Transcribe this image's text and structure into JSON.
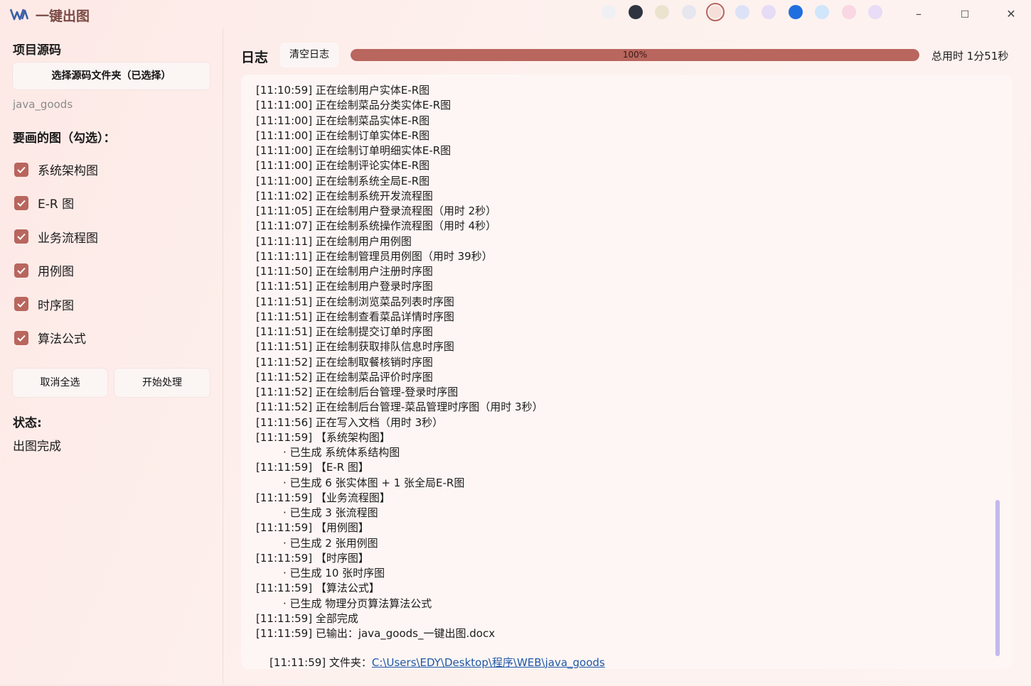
{
  "window": {
    "title": "一键出图",
    "controls": {
      "minimize": "–",
      "maximize": "□",
      "close": "✕"
    }
  },
  "theme": {
    "accent": "#b8665e",
    "swatches": [
      "#eef0f4",
      "#2f3440",
      "#ece3cf",
      "#e6e6ee",
      "#f6dfd9",
      "#dde3f7",
      "#e6dcf6",
      "#1f6fe0",
      "#cfe6fb",
      "#f9d7e3",
      "#e9dcf6"
    ],
    "selected_swatch": 4
  },
  "sidebar": {
    "project_title": "项目源码",
    "select_button": "选择源码文件夹（已选择）",
    "folder_name": "java_goods",
    "diagrams_title": "要画的图（勾选）：",
    "diagrams": [
      {
        "label": "系统架构图",
        "checked": true
      },
      {
        "label": "E-R 图",
        "checked": true
      },
      {
        "label": "业务流程图",
        "checked": true
      },
      {
        "label": "用例图",
        "checked": true
      },
      {
        "label": "时序图",
        "checked": true
      },
      {
        "label": "算法公式",
        "checked": true
      }
    ],
    "deselect_all_button": "取消全选",
    "start_button": "开始处理",
    "status_title": "状态:",
    "status_value": "出图完成"
  },
  "log": {
    "title": "日志",
    "clear_button": "清空日志",
    "progress": 100,
    "progress_text": "100%",
    "total_time": "总用时 1分51秒",
    "link_prefix": "[11:11:59] 文件夹：",
    "link_text": "C:\\Users\\EDY\\Desktop\\程序\\WEB\\java_goods",
    "lines": [
      {
        "text": "[11:10:59] 正在绘制用户实体E-R图"
      },
      {
        "text": "[11:11:00] 正在绘制菜品分类实体E-R图"
      },
      {
        "text": "[11:11:00] 正在绘制菜品实体E-R图"
      },
      {
        "text": "[11:11:00] 正在绘制订单实体E-R图"
      },
      {
        "text": "[11:11:00] 正在绘制订单明细实体E-R图"
      },
      {
        "text": "[11:11:00] 正在绘制评论实体E-R图"
      },
      {
        "text": "[11:11:00] 正在绘制系统全局E-R图"
      },
      {
        "text": "[11:11:02] 正在绘制系统开发流程图"
      },
      {
        "text": "[11:11:05] 正在绘制用户登录流程图（用时 2秒）"
      },
      {
        "text": "[11:11:07] 正在绘制系统操作流程图（用时 4秒）"
      },
      {
        "text": "[11:11:11] 正在绘制用户用例图"
      },
      {
        "text": "[11:11:11] 正在绘制管理员用例图（用时 39秒）"
      },
      {
        "text": "[11:11:50] 正在绘制用户注册时序图"
      },
      {
        "text": "[11:11:51] 正在绘制用户登录时序图"
      },
      {
        "text": "[11:11:51] 正在绘制浏览菜品列表时序图"
      },
      {
        "text": "[11:11:51] 正在绘制查看菜品详情时序图"
      },
      {
        "text": "[11:11:51] 正在绘制提交订单时序图"
      },
      {
        "text": "[11:11:51] 正在绘制获取排队信息时序图"
      },
      {
        "text": "[11:11:52] 正在绘制取餐核销时序图"
      },
      {
        "text": "[11:11:52] 正在绘制菜品评价时序图"
      },
      {
        "text": "[11:11:52] 正在绘制后台管理-登录时序图"
      },
      {
        "text": "[11:11:52] 正在绘制后台管理-菜品管理时序图（用时 3秒）"
      },
      {
        "text": "[11:11:56] 正在写入文档（用时 3秒）"
      },
      {
        "text": "[11:11:59] 【系统架构图】"
      },
      {
        "text": "· 已生成 系统体系结构图",
        "sub": true
      },
      {
        "text": "[11:11:59] 【E-R 图】"
      },
      {
        "text": "· 已生成 6 张实体图 + 1 张全局E-R图",
        "sub": true
      },
      {
        "text": "[11:11:59] 【业务流程图】"
      },
      {
        "text": "· 已生成 3 张流程图",
        "sub": true
      },
      {
        "text": "[11:11:59] 【用例图】"
      },
      {
        "text": "· 已生成 2 张用例图",
        "sub": true
      },
      {
        "text": "[11:11:59] 【时序图】"
      },
      {
        "text": "· 已生成 10 张时序图",
        "sub": true
      },
      {
        "text": "[11:11:59] 【算法公式】"
      },
      {
        "text": "· 已生成 物理分页算法算法公式",
        "sub": true
      },
      {
        "text": "[11:11:59] 全部完成"
      },
      {
        "text": "[11:11:59] 已输出：java_goods_一键出图.docx"
      }
    ]
  }
}
